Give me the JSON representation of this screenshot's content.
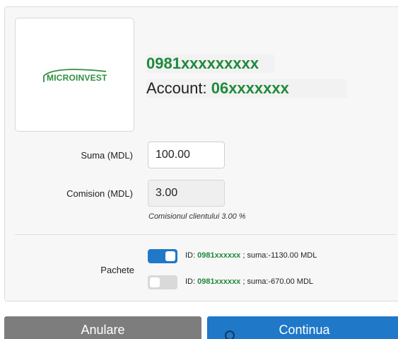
{
  "merchant": {
    "logo_text": "MICROINVEST",
    "phone": "0981xxxxxxxxx",
    "account_label": "Account: ",
    "account_value": "06xxxxxxx"
  },
  "form": {
    "sum_label": "Suma (MDL)",
    "sum_value": "100.00",
    "fee_label": "Comision (MDL)",
    "fee_value": "3.00",
    "fee_note": "Comisionul clientului 3.00 %"
  },
  "packages": {
    "label": "Pachete",
    "items": [
      {
        "id_label": "ID: ",
        "id": "0981xxxxxx",
        "amount_text": " ; suma:-1130.00 MDL",
        "enabled": true
      },
      {
        "id_label": "ID: ",
        "id": "0981xxxxxx",
        "amount_text": " ; suma:-670.00 MDL",
        "enabled": false
      }
    ]
  },
  "buttons": {
    "cancel": "Anulare",
    "continue": "Continua"
  },
  "colors": {
    "accent": "#1f78c8",
    "brand_green": "#1f8a3c",
    "cancel_gray": "#7d7d7d"
  }
}
